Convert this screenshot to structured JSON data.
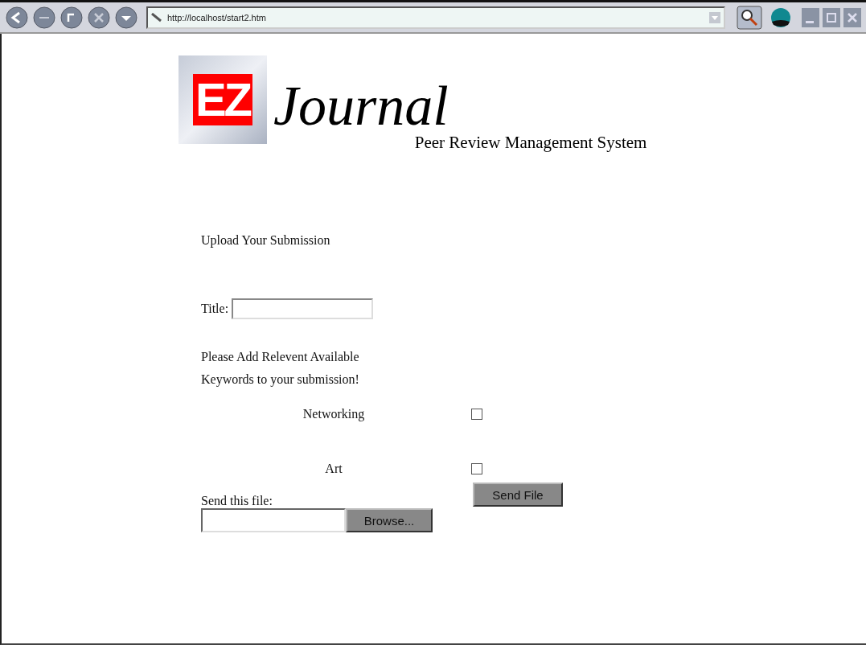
{
  "browser": {
    "url": "http://localhost/start2.htm"
  },
  "logo": {
    "badge": "EZ",
    "name": "Journal",
    "tagline": "Peer Review Management System"
  },
  "form": {
    "heading": "Upload Your Submission",
    "title_label": "Title:",
    "keywords_prompt": [
      "Please Add Relevent Available",
      "Keywords to your submission!"
    ],
    "keywords": [
      {
        "label": "Networking",
        "checked": false
      },
      {
        "label": "Art",
        "checked": false
      }
    ],
    "file_label": "Send this file:",
    "browse_button": "Browse...",
    "send_button": "Send File"
  }
}
